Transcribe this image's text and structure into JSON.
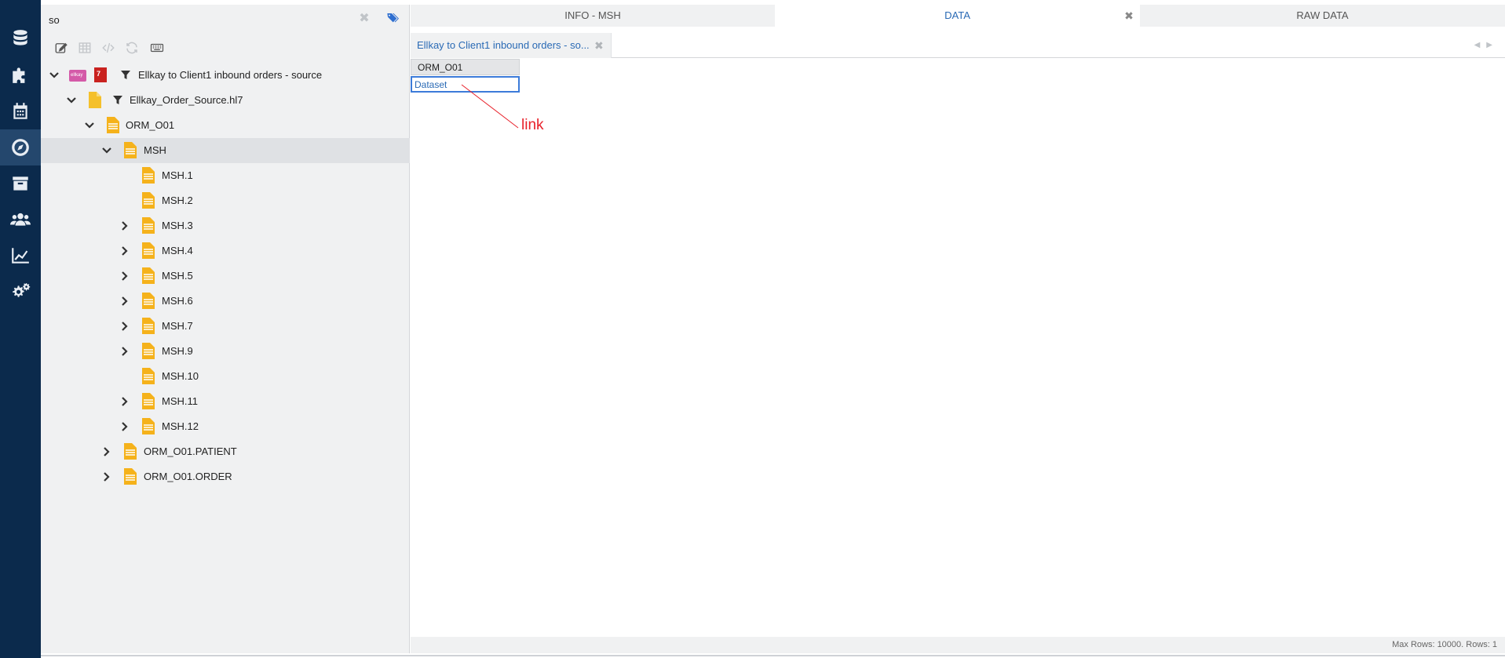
{
  "rail": {
    "items": [
      {
        "icon": "database-icon"
      },
      {
        "icon": "puzzle-icon"
      },
      {
        "icon": "calendar-icon"
      },
      {
        "icon": "compass-icon",
        "active": true
      },
      {
        "icon": "archive-icon"
      },
      {
        "icon": "users-icon"
      },
      {
        "icon": "chart-line-icon"
      },
      {
        "icon": "gears-icon"
      }
    ]
  },
  "tree_panel": {
    "search": {
      "value": "so",
      "placeholder": ""
    },
    "toolbar": [
      "edit-icon",
      "table-icon",
      "code-icon",
      "refresh-icon",
      "keyboard-icon"
    ],
    "nodes": [
      {
        "label": "Ellkay to Client1 inbound orders - source"
      },
      {
        "label": "Ellkay_Order_Source.hl7"
      },
      {
        "label": "ORM_O01"
      },
      {
        "label": "MSH"
      },
      {
        "label": "MSH.1"
      },
      {
        "label": "MSH.2"
      },
      {
        "label": "MSH.3"
      },
      {
        "label": "MSH.4"
      },
      {
        "label": "MSH.5"
      },
      {
        "label": "MSH.6"
      },
      {
        "label": "MSH.7"
      },
      {
        "label": "MSH.9"
      },
      {
        "label": "MSH.10"
      },
      {
        "label": "MSH.11"
      },
      {
        "label": "MSH.12"
      },
      {
        "label": "ORM_O01.PATIENT"
      },
      {
        "label": "ORM_O01.ORDER"
      }
    ]
  },
  "tabs": [
    {
      "label": "INFO - MSH"
    },
    {
      "label": "DATA",
      "active": true
    },
    {
      "label": "RAW DATA"
    }
  ],
  "subtab": {
    "label": "Ellkay to Client1 inbound orders - so..."
  },
  "grid": {
    "header": "ORM_O01",
    "cell": "Dataset"
  },
  "annotation": {
    "text": "link"
  },
  "status": {
    "text": "Max Rows: 10000. Rows: 1"
  },
  "colors": {
    "rail": "#0b2a4c",
    "accent": "#2a6ab5",
    "annotation": "#e8212a",
    "doc": "#f5b21b"
  }
}
